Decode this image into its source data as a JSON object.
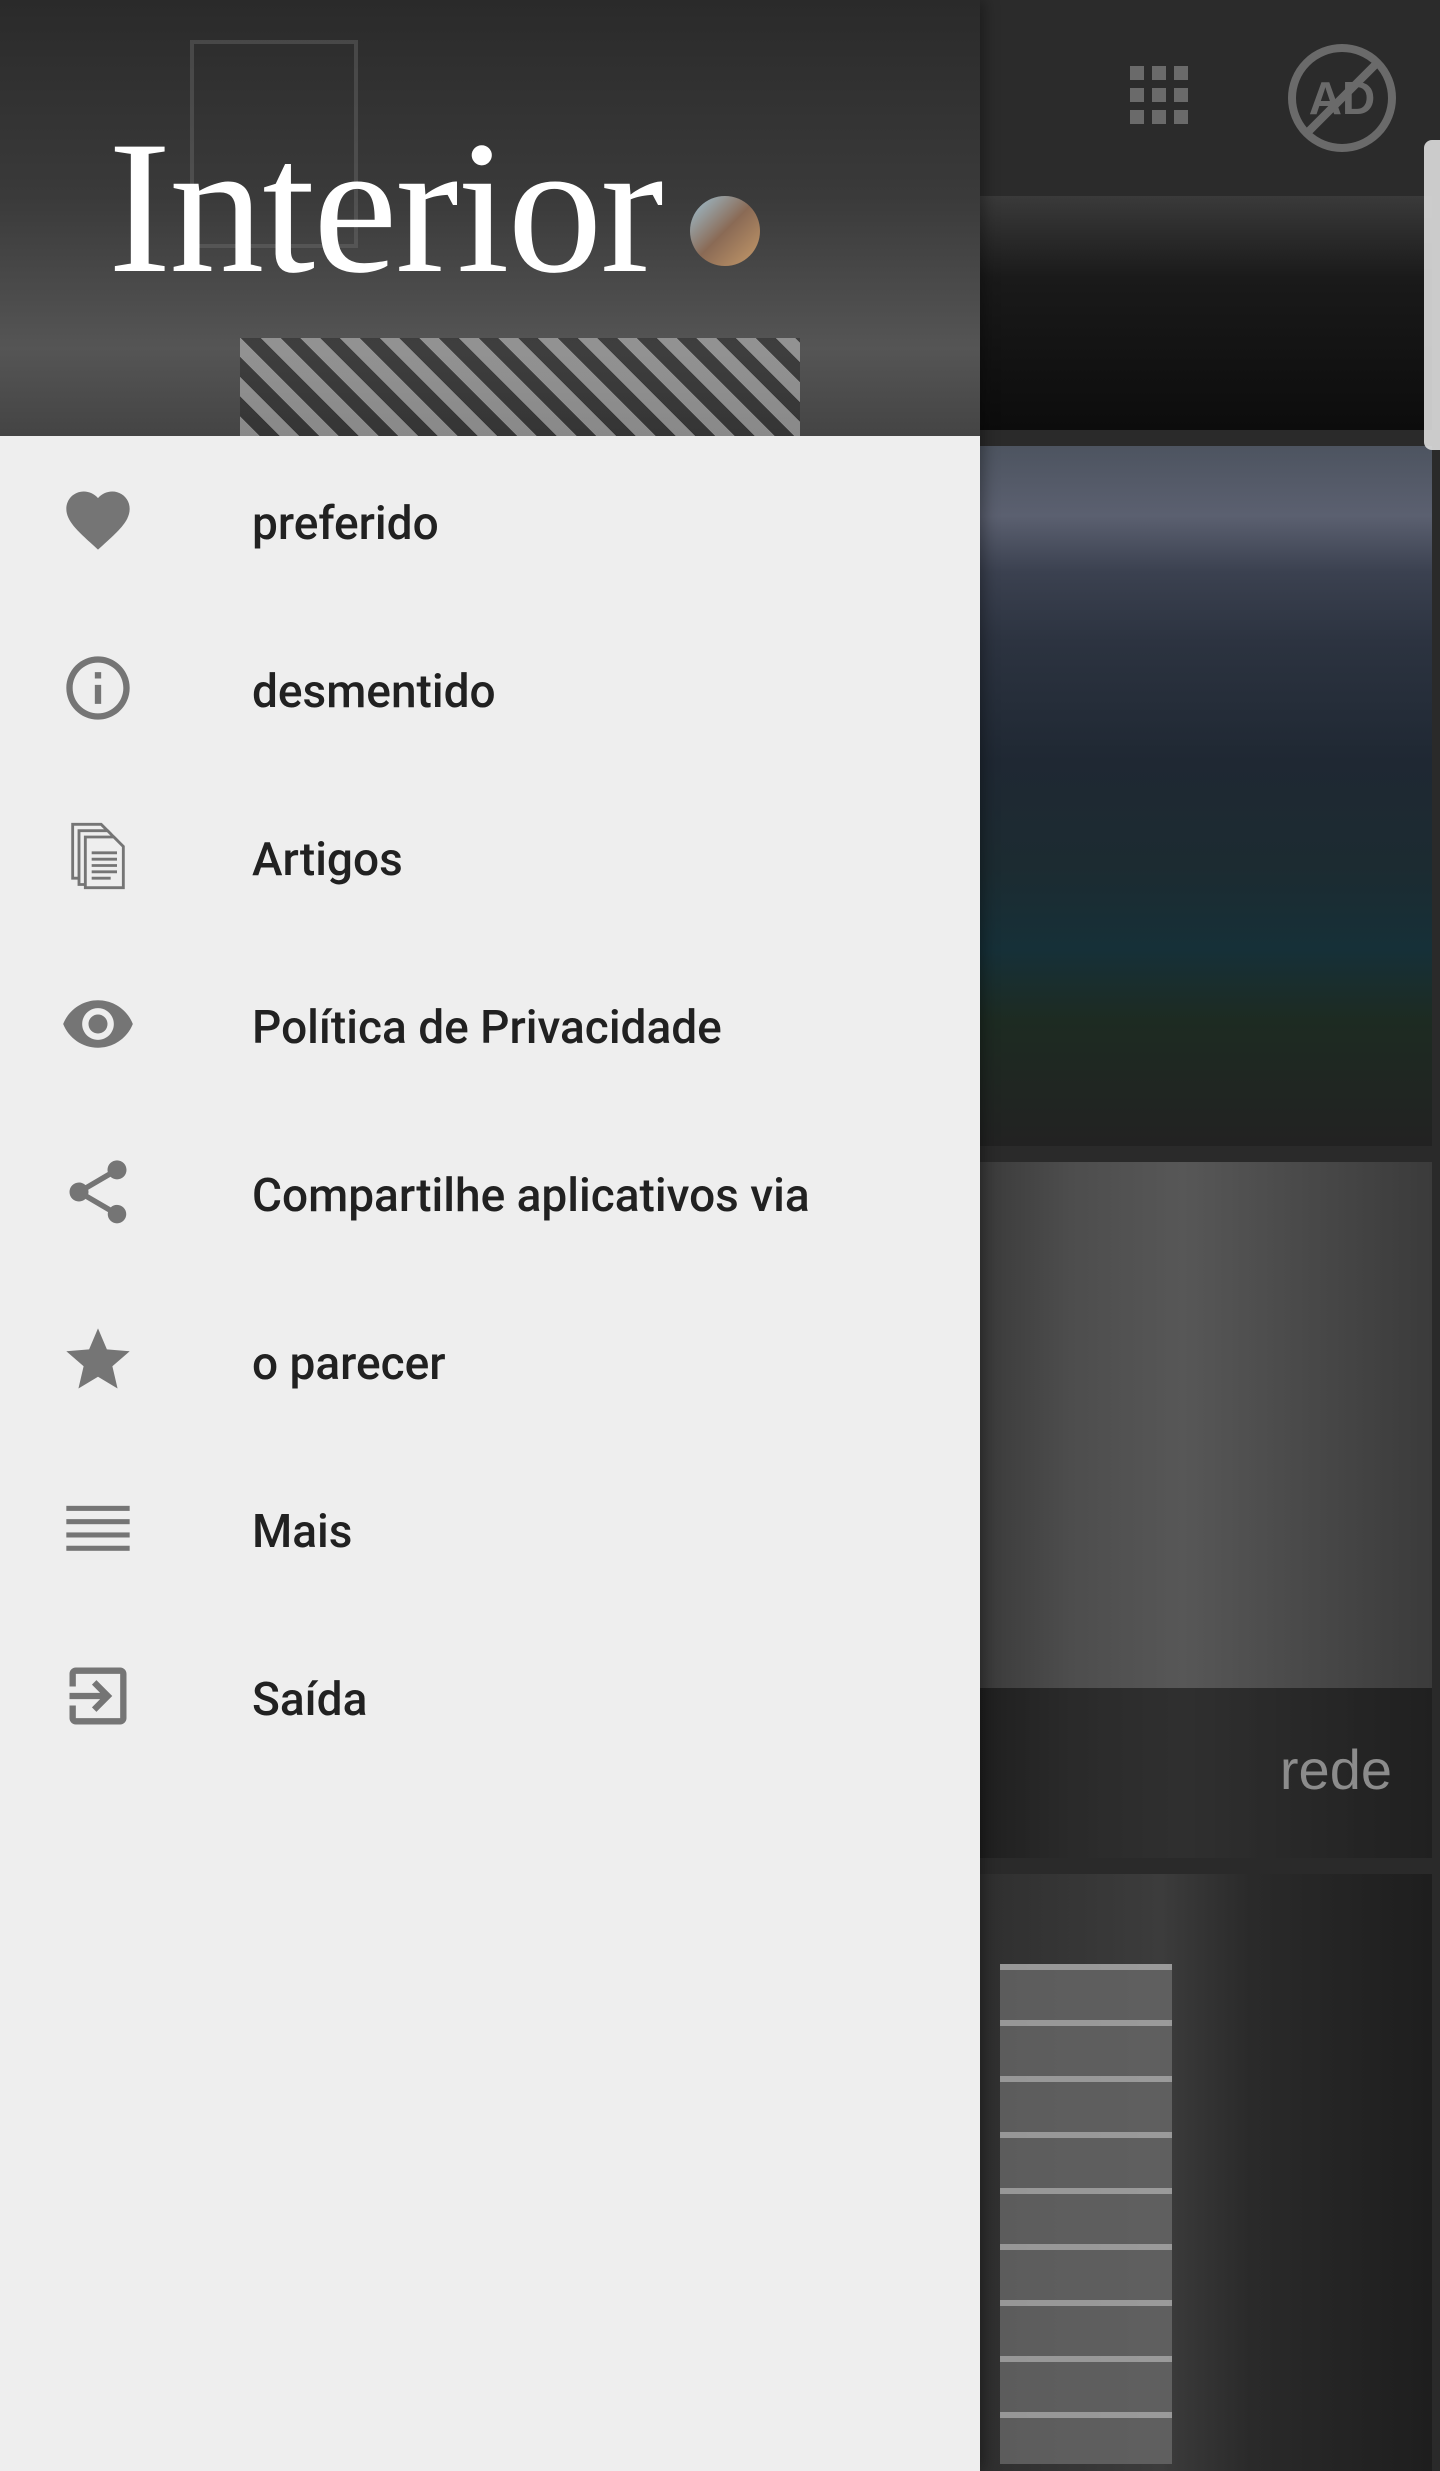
{
  "header": {
    "logo_text": "Interior"
  },
  "menu": {
    "items": [
      {
        "label": "preferido",
        "icon": "heart-icon"
      },
      {
        "label": "desmentido",
        "icon": "info-icon"
      },
      {
        "label": "Artigos",
        "icon": "documents-icon"
      },
      {
        "label": "Política de Privacidade",
        "icon": "eye-icon"
      },
      {
        "label": "Compartilhe aplicativos via",
        "icon": "share-icon"
      },
      {
        "label": "o parecer",
        "icon": "star-icon"
      },
      {
        "label": "Mais",
        "icon": "menu-lines-icon"
      },
      {
        "label": "Saída",
        "icon": "exit-icon"
      }
    ]
  },
  "background": {
    "toolbar_icons": [
      "grid-icon",
      "ad-block-icon"
    ],
    "ad_icon_text": "AD",
    "card_caption": "rede"
  },
  "colors": {
    "drawer_bg": "#eeeeee",
    "menu_text": "#212121",
    "menu_icon": "#757575",
    "toolbar": "#2b2b2b"
  }
}
